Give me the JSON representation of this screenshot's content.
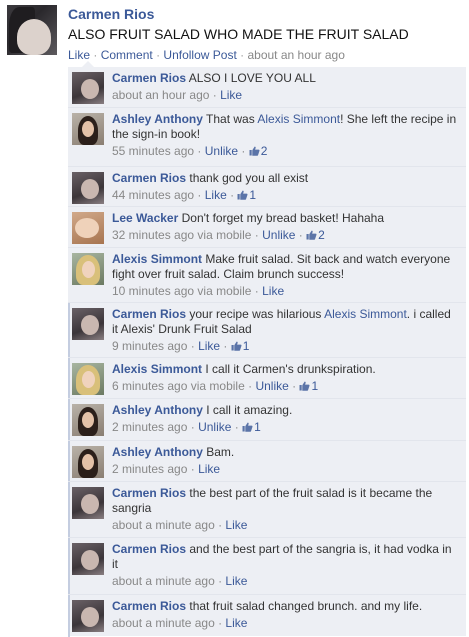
{
  "post": {
    "author": "Carmen Rios",
    "text": "ALSO FRUIT SALAD WHO MADE THE FRUIT SALAD",
    "actions": {
      "like": "Like",
      "comment": "Comment",
      "unfollow": "Unfollow Post",
      "time": "about an hour ago",
      "separator": "·"
    }
  },
  "comments": [
    {
      "author": "Carmen Rios",
      "avatar": "carmen",
      "text": "ALSO I LOVE YOU ALL",
      "time": "about an hour ago",
      "via": "",
      "action": "Like",
      "likes": ""
    },
    {
      "author": "Ashley Anthony",
      "avatar": "ashley",
      "text_before": "That was ",
      "mention": "Alexis Simmont",
      "text_after": "! She left the recipe in the sign-in book!",
      "time": "55 minutes ago",
      "via": "",
      "action": "Unlike",
      "likes": "2"
    },
    {
      "author": "Carmen Rios",
      "avatar": "carmen",
      "text": "thank god you all exist",
      "time": "44 minutes ago",
      "via": "",
      "action": "Like",
      "likes": "1"
    },
    {
      "author": "Lee Wacker",
      "avatar": "lee",
      "text": "Don't forget my bread basket! Hahaha",
      "time": "32 minutes ago",
      "via": "via mobile",
      "action": "Unlike",
      "likes": "2"
    },
    {
      "author": "Alexis Simmont",
      "avatar": "alexis",
      "text": "Make fruit salad. Sit back and watch everyone fight over fruit salad. Claim brunch success!",
      "time": "10 minutes ago",
      "via": "via mobile",
      "action": "Like",
      "likes": ""
    },
    {
      "author": "Carmen Rios",
      "avatar": "carmen",
      "text_before": "your recipe was hilarious ",
      "mention": "Alexis Simmont",
      "text_after": ". i called it Alexis' Drunk Fruit Salad",
      "time": "9 minutes ago",
      "via": "",
      "action": "Like",
      "likes": "1"
    },
    {
      "author": "Alexis Simmont",
      "avatar": "alexis",
      "text": "I call it Carmen's drunkspiration.",
      "time": "6 minutes ago",
      "via": "via mobile",
      "action": "Unlike",
      "likes": "1"
    },
    {
      "author": "Ashley Anthony",
      "avatar": "ashley",
      "text": "I call it amazing.",
      "time": "2 minutes ago",
      "via": "",
      "action": "Unlike",
      "likes": "1"
    },
    {
      "author": "Ashley Anthony",
      "avatar": "ashley",
      "text": "Bam.",
      "time": "2 minutes ago",
      "via": "",
      "action": "Like",
      "likes": ""
    },
    {
      "author": "Carmen Rios",
      "avatar": "carmen",
      "text": "the best part of the fruit salad is it became the sangria",
      "time": "about a minute ago",
      "via": "",
      "action": "Like",
      "likes": ""
    },
    {
      "author": "Carmen Rios",
      "avatar": "carmen",
      "text": "and the best part of the sangria is, it had vodka in it",
      "time": "about a minute ago",
      "via": "",
      "action": "Like",
      "likes": ""
    },
    {
      "author": "Carmen Rios",
      "avatar": "carmen",
      "text": "that fruit salad changed brunch. and my life.",
      "time": "about a minute ago",
      "via": "",
      "action": "Like",
      "likes": ""
    }
  ],
  "colors": {
    "link": "#3b5998",
    "meta": "#888888",
    "comment_bg": "#edeff4"
  },
  "icons": {
    "like_count": "thumbs-up-icon"
  }
}
